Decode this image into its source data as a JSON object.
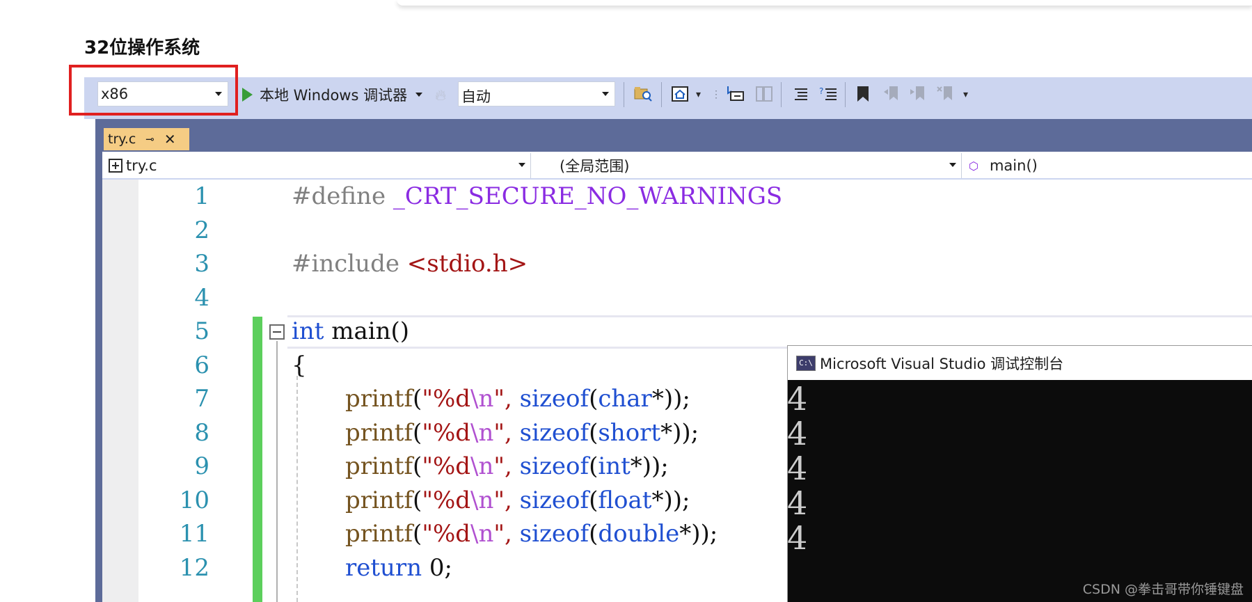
{
  "heading": "32位操作系统",
  "toolbar": {
    "platform": "x86",
    "debugger_label": "本地 Windows 调试器",
    "config": "自动"
  },
  "editor": {
    "tab_label": "try.c",
    "tab_pin": "⊸",
    "tab_close": "✕",
    "nav_file": "try.c",
    "nav_scope": "(全局范围)",
    "nav_member": "main()",
    "line_numbers": [
      "1",
      "2",
      "3",
      "4",
      "5",
      "6",
      "7",
      "8",
      "9",
      "10",
      "11",
      "12"
    ],
    "code": {
      "l1_directive": "#define",
      "l1_macro": "_CRT_SECURE_NO_WARNINGS",
      "l3_directive": "#include",
      "l3_header": "<stdio.h>",
      "l5_type": "int",
      "l5_name": "main()",
      "l6_brace": "{",
      "printf": "printf",
      "fmt_open": "\"%d",
      "fmt_esc": "\\n",
      "fmt_close": "\",",
      "sizeof": "sizeof",
      "l7_type": "char",
      "l8_type": "short",
      "l9_type": "int",
      "l10_type": "float",
      "l11_type": "double",
      "ptr_close_7": "*));",
      "ptr_close_8": "*));",
      "ptr_close_9": "*));",
      "ptr_close_10": "*));",
      "ptr_close_11": "*));",
      "l12_return": "return",
      "l12_value": "0;"
    }
  },
  "console": {
    "title": "Microsoft Visual Studio 调试控制台",
    "icon_text": "C:\\",
    "output": [
      "4",
      "4",
      "4",
      "4",
      "4"
    ]
  },
  "watermark": "CSDN @拳击哥带你锤键盘"
}
